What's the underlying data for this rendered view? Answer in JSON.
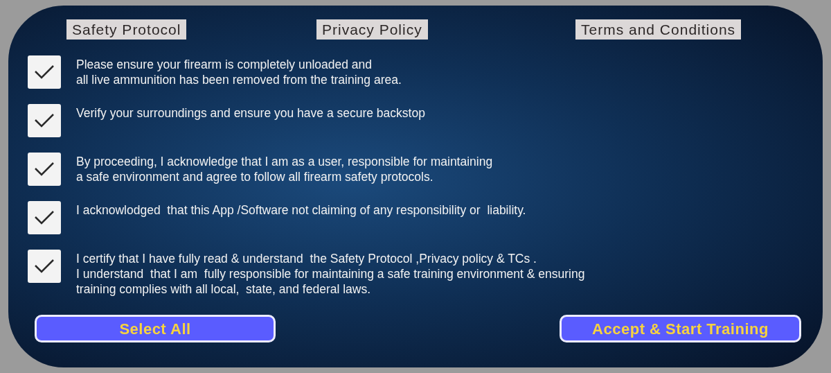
{
  "tabs": [
    {
      "label": "Safety Protocol"
    },
    {
      "label": "Privacy Policy"
    },
    {
      "label": "Terms and Conditions"
    }
  ],
  "agreements": [
    {
      "text": "Please ensure your firearm is completely unloaded and\nall live ammunition has been removed from the training area.",
      "checked": true
    },
    {
      "text": "Verify your surroundings and ensure you have a secure backstop",
      "checked": true
    },
    {
      "text": "By proceeding, I acknowledge that I am as a user, responsible for maintaining\na safe environment and agree to follow all firearm safety protocols.",
      "checked": true
    },
    {
      "text": "I acknowlodged  that this App /Software not claiming of any responsibility or  liability.",
      "checked": true
    },
    {
      "text": "I certify that I have fully read & understand  the Safety Protocol ,Privacy policy & TCs .\nI understand  that I am  fully responsible for maintaining a safe training environment & ensuring\ntraining complies with all local,  state, and federal laws.",
      "checked": true
    }
  ],
  "buttons": [
    {
      "label": "Select All"
    },
    {
      "label": "Accept & Start Training"
    }
  ]
}
